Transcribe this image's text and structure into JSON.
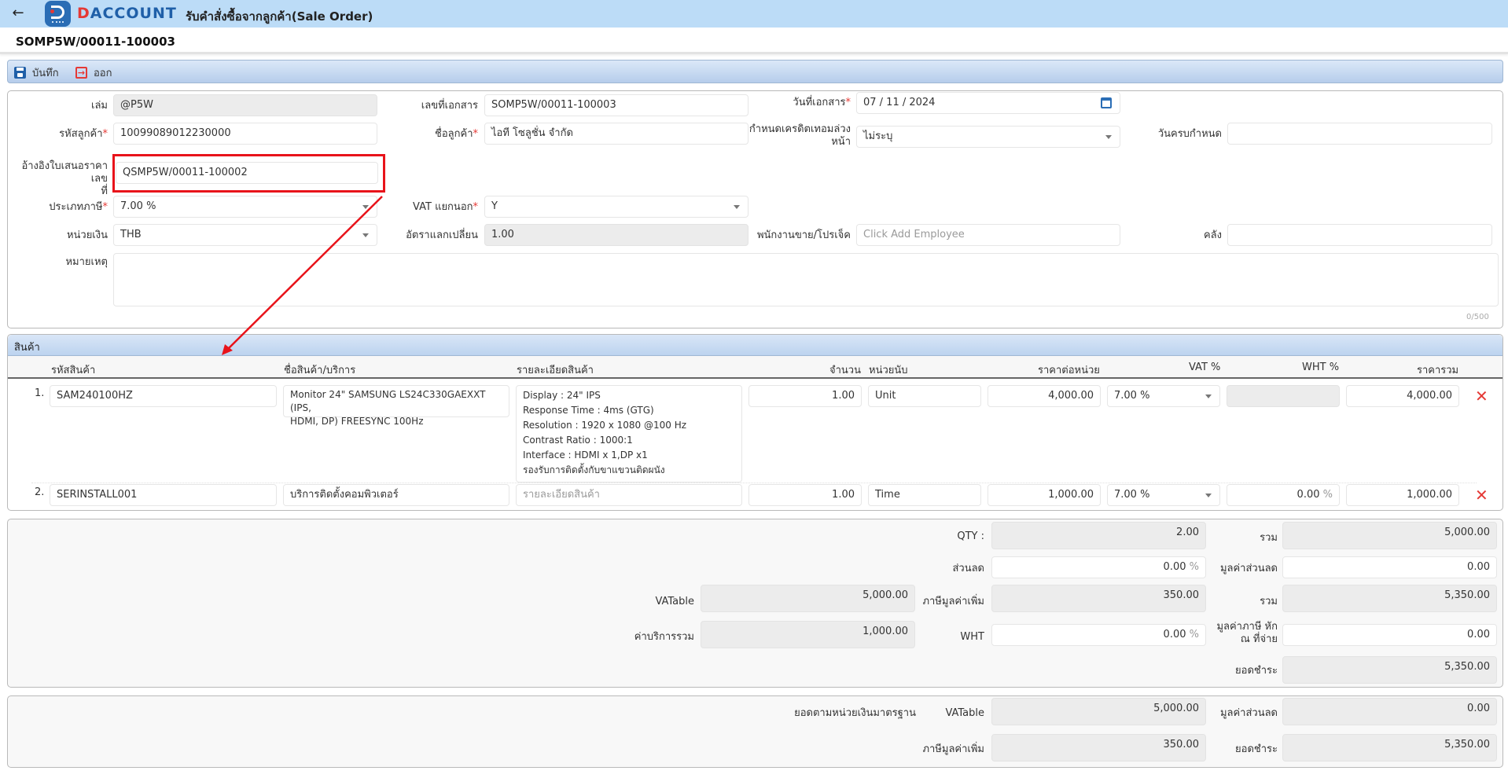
{
  "header": {
    "back_icon": "arrow-left-icon",
    "brand_prefix": "D",
    "brand_rest": "ACCOUNT",
    "page_heading": "รับคำสั่งซื้อจากลูกค้า(Sale Order)"
  },
  "doc_title": "SOMP5W/00011-100003",
  "toolbar": {
    "save_label": "บันทึก",
    "exit_label": "ออก"
  },
  "form": {
    "book": {
      "label": "เล่ม",
      "value": "@P5W"
    },
    "doc_no": {
      "label": "เลขที่เอกสาร",
      "value": "SOMP5W/00011-100003"
    },
    "doc_date": {
      "label": "วันที่เอกสาร",
      "value": "07 / 11 / 2024"
    },
    "customer_code": {
      "label": "รหัสลูกค้า",
      "value": "10099089012230000"
    },
    "customer_name": {
      "label": "ชื่อลูกค้า",
      "value": "ไอที โซลูชั่น จำกัด"
    },
    "credit_term": {
      "label_line1": "กำหนดเครดิตเทอมล่วง",
      "label_line2": "หน้า",
      "value": "ไม่ระบุ"
    },
    "due_date": {
      "label": "วันครบกำหนด",
      "value": ""
    },
    "quotation_ref": {
      "label_line1": "อ้างอิงใบเสนอราคาเลข",
      "label_line2": "ที่",
      "value": "QSMP5W/00011-100002"
    },
    "tax_type": {
      "label": "ประเภทภาษี",
      "value": "7.00 %"
    },
    "vat_separate": {
      "label": "VAT แยกนอก",
      "value": "Y"
    },
    "currency": {
      "label": "หน่วยเงิน",
      "value": "THB"
    },
    "exchange_rate": {
      "label": "อัตราแลกเปลี่ยน",
      "value": "1.00"
    },
    "salesperson": {
      "label": "พนักงานขาย/โปรเจ็ค",
      "placeholder": "Click Add Employee"
    },
    "warehouse": {
      "label": "คลัง",
      "value": ""
    },
    "note": {
      "label": "หมายเหตุ",
      "value": "",
      "counter": "0/500"
    }
  },
  "products": {
    "section_title": "สินค้า",
    "columns": [
      "รหัสสินค้า",
      "ชื่อสินค้า/บริการ",
      "รายละเอียดสินค้า",
      "จำนวน",
      "หน่วยนับ",
      "ราคาต่อหน่วย",
      "VAT %",
      "WHT %",
      "ราคารวม"
    ],
    "rows": [
      {
        "num": "1.",
        "code": "SAM240100HZ",
        "name_line1": "Monitor 24\" SAMSUNG LS24C330GAEXXT (IPS,",
        "name_line2": "HDMI, DP) FREESYNC 100Hz",
        "details": [
          "Display : 24\" IPS",
          "Response Time : 4ms (GTG)",
          "Resolution : 1920 x 1080 @100 Hz",
          "Contrast Ratio : 1000:1",
          "Interface : HDMI x 1,DP x1",
          "รองรับการติดตั้งกับขาแขวนติดผนัง"
        ],
        "qty": "1.00",
        "unit": "Unit",
        "unit_price": "4,000.00",
        "vat": "7.00 %",
        "wht": "",
        "total": "4,000.00"
      },
      {
        "num": "2.",
        "code": "SERINSTALL001",
        "name_line1": "บริการติดตั้งคอมพิวเตอร์",
        "name_line2": "",
        "details_placeholder": "รายละเอียดสินค้า",
        "qty": "1.00",
        "unit": "Time",
        "unit_price": "1,000.00",
        "vat": "7.00 %",
        "wht": "0.00",
        "wht_unit": "%",
        "total": "1,000.00"
      }
    ],
    "delete_icon": "close-x-icon"
  },
  "summary": {
    "qty": {
      "label": "QTY :",
      "value": "2.00"
    },
    "subtotal": {
      "label": "รวม",
      "value": "5,000.00"
    },
    "discount_pct": {
      "label": "ส่วนลด",
      "value": "0.00",
      "unit": "%"
    },
    "discount_amount": {
      "label": "มูลค่าส่วนลด",
      "value": "0.00"
    },
    "vatable": {
      "label": "VATable",
      "value": "5,000.00"
    },
    "vat_amount": {
      "label": "ภาษีมูลค่าเพิ่ม",
      "value": "350.00"
    },
    "total": {
      "label": "รวม",
      "value": "5,350.00"
    },
    "service_total": {
      "label": "ค่าบริการรวม",
      "value": "1,000.00"
    },
    "wht_pct": {
      "label": "WHT",
      "value": "0.00",
      "unit": "%"
    },
    "wht_amount": {
      "label_line1": "มูลค่าภาษี หัก",
      "label_line2": "ณ ที่จ่าย",
      "value": "0.00"
    },
    "net_payable": {
      "label": "ยอดชำระ",
      "value": "5,350.00"
    }
  },
  "base_currency": {
    "title": "ยอดตามหน่วยเงินมาตรฐาน",
    "vatable": {
      "label": "VATable",
      "value": "5,000.00"
    },
    "discount_amount": {
      "label": "มูลค่าส่วนลด",
      "value": "0.00"
    },
    "vat_amount": {
      "label": "ภาษีมูลค่าเพิ่ม",
      "value": "350.00"
    },
    "net_payable": {
      "label": "ยอดชำระ",
      "value": "5,350.00"
    }
  },
  "annotation": {
    "highlight_color": "#e8131a"
  }
}
